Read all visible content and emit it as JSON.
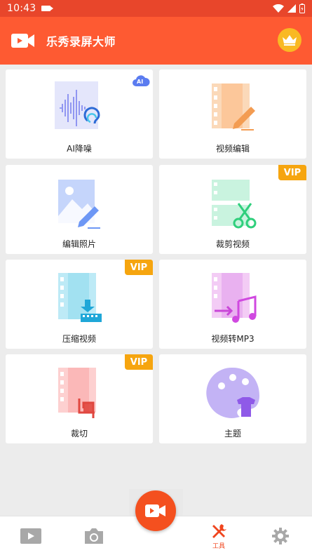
{
  "status": {
    "time": "10:43"
  },
  "header": {
    "title": "乐秀录屏大师"
  },
  "tools": [
    {
      "label": "AI降噪",
      "badge": "AI",
      "vip": ""
    },
    {
      "label": "视频编辑",
      "badge": "",
      "vip": ""
    },
    {
      "label": "编辑照片",
      "badge": "",
      "vip": ""
    },
    {
      "label": "裁剪视频",
      "badge": "",
      "vip": "VIP"
    },
    {
      "label": "压缩视频",
      "badge": "",
      "vip": "VIP"
    },
    {
      "label": "视频转MP3",
      "badge": "",
      "vip": ""
    },
    {
      "label": "裁切",
      "badge": "",
      "vip": "VIP"
    },
    {
      "label": "主题",
      "badge": "",
      "vip": ""
    }
  ],
  "nav": {
    "tools_label": "工具"
  },
  "colors": {
    "primary": "#fe5a32",
    "status_bar": "#e8462b",
    "vip": "#f6a50f",
    "crown": "#f9b923"
  },
  "icons": [
    "video-logo-icon",
    "crown-icon",
    "noise-reduction-icon",
    "video-edit-icon",
    "photo-edit-icon",
    "video-cut-icon",
    "video-compress-icon",
    "video-to-mp3-icon",
    "crop-icon",
    "theme-palette-icon",
    "play-icon",
    "camera-icon",
    "tools-icon",
    "settings-icon",
    "record-icon"
  ]
}
